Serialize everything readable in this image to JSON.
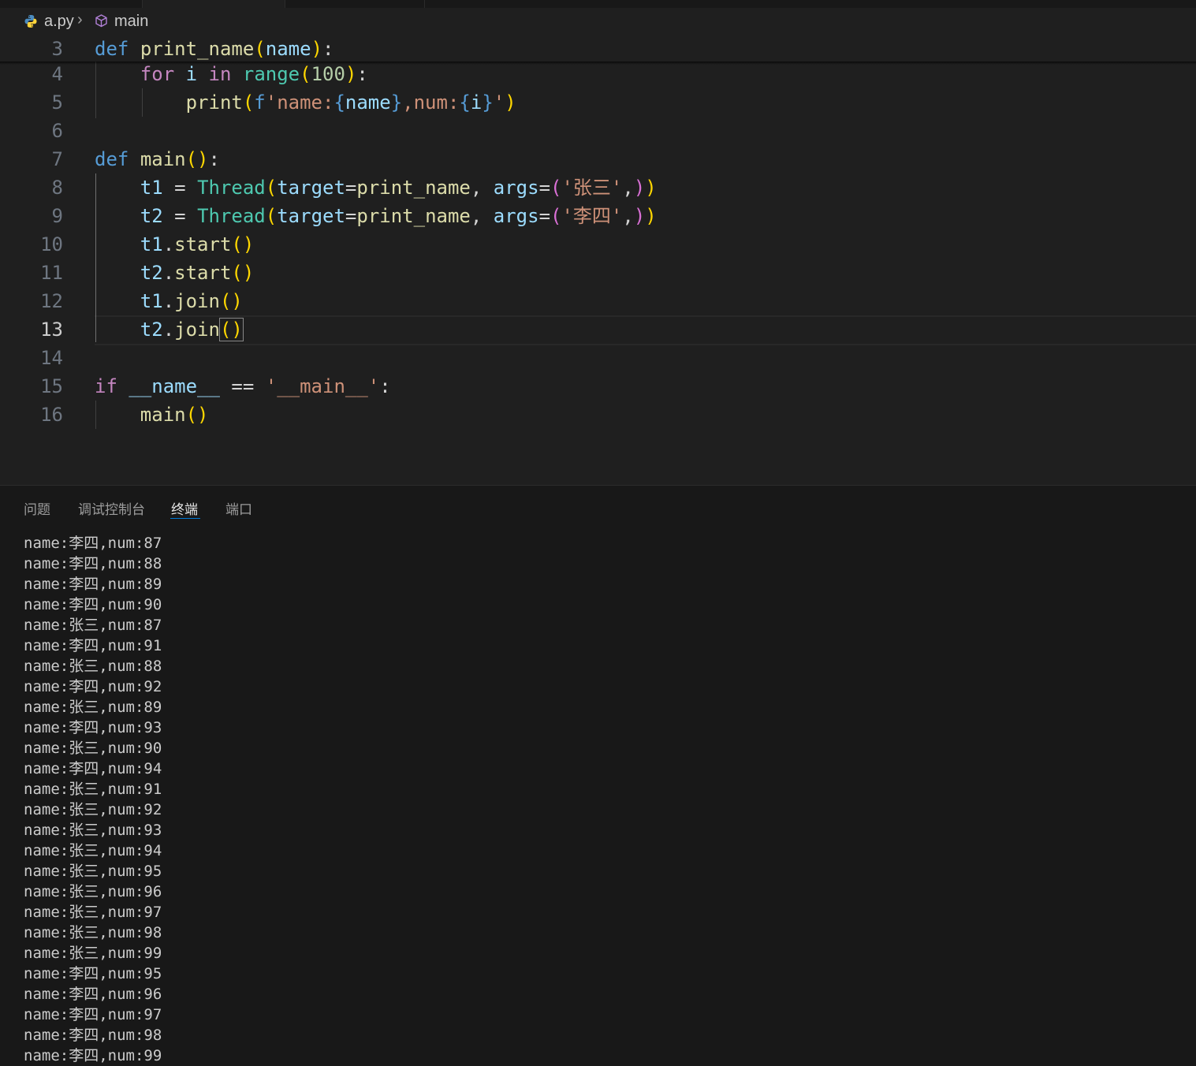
{
  "breadcrumb": {
    "file": "a.py",
    "separator": "›",
    "symbol": "main",
    "file_icon": "python-icon",
    "symbol_icon": "cube-icon"
  },
  "code_lines": [
    {
      "ln": "3",
      "tokens": [
        [
          "k",
          "def"
        ],
        [
          "w",
          " "
        ],
        [
          "f",
          "print_name"
        ],
        [
          "b1",
          "("
        ],
        [
          "v",
          "name"
        ],
        [
          "b1",
          ")"
        ],
        [
          "w",
          ":"
        ]
      ]
    },
    {
      "ln": "4",
      "tokens": [
        [
          "w",
          "    "
        ],
        [
          "kc",
          "for"
        ],
        [
          "w",
          " "
        ],
        [
          "v",
          "i"
        ],
        [
          "w",
          " "
        ],
        [
          "kc",
          "in"
        ],
        [
          "w",
          " "
        ],
        [
          "c",
          "range"
        ],
        [
          "b1",
          "("
        ],
        [
          "n",
          "100"
        ],
        [
          "b1",
          ")"
        ],
        [
          "w",
          ":"
        ]
      ]
    },
    {
      "ln": "5",
      "tokens": [
        [
          "w",
          "        "
        ],
        [
          "f",
          "print"
        ],
        [
          "b1",
          "("
        ],
        [
          "k",
          "f"
        ],
        [
          "s",
          "'name:"
        ],
        [
          "k",
          "{"
        ],
        [
          "v",
          "name"
        ],
        [
          "k",
          "}"
        ],
        [
          "s",
          ",num:"
        ],
        [
          "k",
          "{"
        ],
        [
          "v",
          "i"
        ],
        [
          "k",
          "}"
        ],
        [
          "s",
          "'"
        ],
        [
          "b1",
          ")"
        ]
      ]
    },
    {
      "ln": "6",
      "tokens": []
    },
    {
      "ln": "7",
      "tokens": [
        [
          "k",
          "def"
        ],
        [
          "w",
          " "
        ],
        [
          "f",
          "main"
        ],
        [
          "b1",
          "()"
        ],
        [
          "w",
          ":"
        ]
      ]
    },
    {
      "ln": "8",
      "tokens": [
        [
          "w",
          "    "
        ],
        [
          "v",
          "t1"
        ],
        [
          "w",
          " = "
        ],
        [
          "c",
          "Thread"
        ],
        [
          "b1",
          "("
        ],
        [
          "v",
          "target"
        ],
        [
          "w",
          "="
        ],
        [
          "f",
          "print_name"
        ],
        [
          "w",
          ", "
        ],
        [
          "v",
          "args"
        ],
        [
          "w",
          "="
        ],
        [
          "b2",
          "("
        ],
        [
          "s",
          "'张三'"
        ],
        [
          "w",
          ","
        ],
        [
          "b2",
          ")"
        ],
        [
          "b1",
          ")"
        ]
      ]
    },
    {
      "ln": "9",
      "tokens": [
        [
          "w",
          "    "
        ],
        [
          "v",
          "t2"
        ],
        [
          "w",
          " = "
        ],
        [
          "c",
          "Thread"
        ],
        [
          "b1",
          "("
        ],
        [
          "v",
          "target"
        ],
        [
          "w",
          "="
        ],
        [
          "f",
          "print_name"
        ],
        [
          "w",
          ", "
        ],
        [
          "v",
          "args"
        ],
        [
          "w",
          "="
        ],
        [
          "b2",
          "("
        ],
        [
          "s",
          "'李四'"
        ],
        [
          "w",
          ","
        ],
        [
          "b2",
          ")"
        ],
        [
          "b1",
          ")"
        ]
      ]
    },
    {
      "ln": "10",
      "tokens": [
        [
          "w",
          "    "
        ],
        [
          "v",
          "t1"
        ],
        [
          "w",
          "."
        ],
        [
          "f",
          "start"
        ],
        [
          "b1",
          "()"
        ]
      ]
    },
    {
      "ln": "11",
      "tokens": [
        [
          "w",
          "    "
        ],
        [
          "v",
          "t2"
        ],
        [
          "w",
          "."
        ],
        [
          "f",
          "start"
        ],
        [
          "b1",
          "()"
        ]
      ]
    },
    {
      "ln": "12",
      "tokens": [
        [
          "w",
          "    "
        ],
        [
          "v",
          "t1"
        ],
        [
          "w",
          "."
        ],
        [
          "f",
          "join"
        ],
        [
          "b1",
          "()"
        ]
      ]
    },
    {
      "ln": "13",
      "tokens": [
        [
          "w",
          "    "
        ],
        [
          "v",
          "t2"
        ],
        [
          "w",
          "."
        ],
        [
          "f",
          "join"
        ],
        [
          "b1 caret-box",
          "()"
        ]
      ],
      "current": true
    },
    {
      "ln": "14",
      "tokens": []
    },
    {
      "ln": "15",
      "tokens": [
        [
          "kc",
          "if"
        ],
        [
          "w",
          " "
        ],
        [
          "v",
          "__name__"
        ],
        [
          "w",
          " == "
        ],
        [
          "s",
          "'__main__'"
        ],
        [
          "w",
          ":"
        ]
      ]
    },
    {
      "ln": "16",
      "tokens": [
        [
          "w",
          "    "
        ],
        [
          "f",
          "main"
        ],
        [
          "b1",
          "()"
        ]
      ]
    }
  ],
  "panel": {
    "tabs": [
      "问题",
      "调试控制台",
      "终端",
      "端口"
    ],
    "active_tab": "终端"
  },
  "terminal_lines": [
    "name:李四,num:87",
    "name:李四,num:88",
    "name:李四,num:89",
    "name:李四,num:90",
    "name:张三,num:87",
    "name:李四,num:91",
    "name:张三,num:88",
    "name:李四,num:92",
    "name:张三,num:89",
    "name:李四,num:93",
    "name:张三,num:90",
    "name:李四,num:94",
    "name:张三,num:91",
    "name:张三,num:92",
    "name:张三,num:93",
    "name:张三,num:94",
    "name:张三,num:95",
    "name:张三,num:96",
    "name:张三,num:97",
    "name:张三,num:98",
    "name:张三,num:99",
    "name:李四,num:95",
    "name:李四,num:96",
    "name:李四,num:97",
    "name:李四,num:98",
    "name:李四,num:99"
  ]
}
